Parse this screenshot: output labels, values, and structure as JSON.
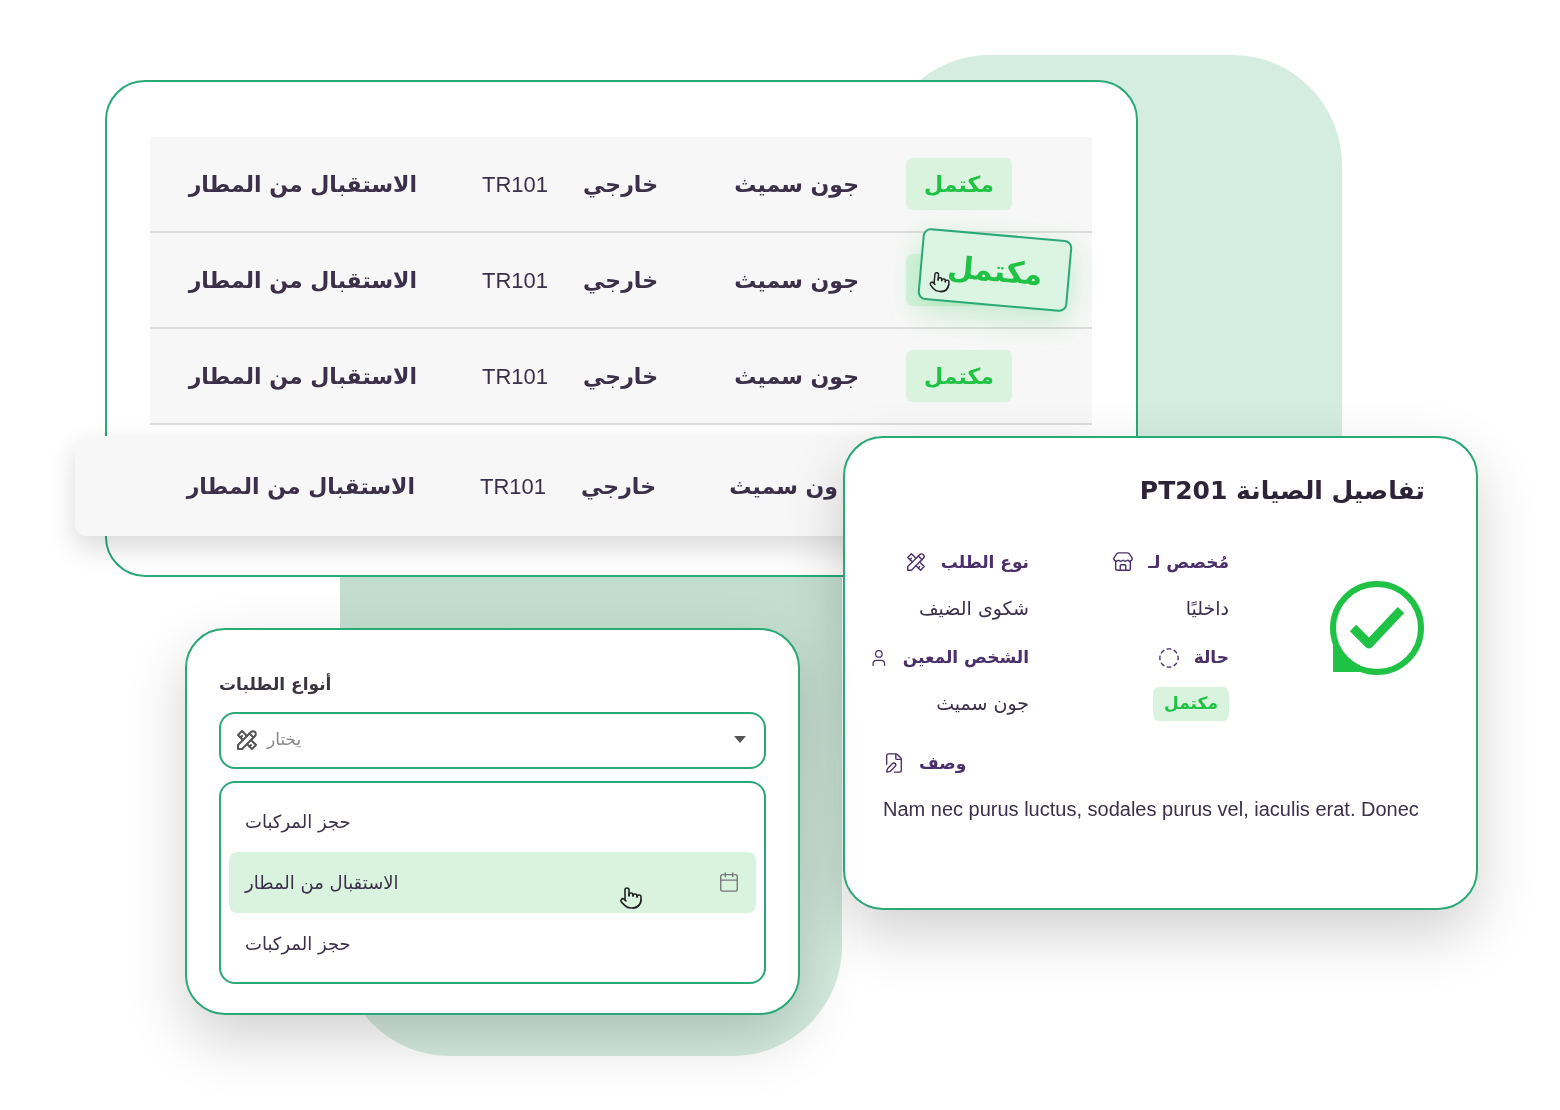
{
  "table": {
    "rows": [
      {
        "kind": "static",
        "status": "مكتمل",
        "name": "جون سميث",
        "type": "خارجي",
        "code": "TR101",
        "request": "الاستقبال من المطار"
      },
      {
        "kind": "dragged",
        "status": "مكتمل",
        "name": "جون سميث",
        "type": "خارجي",
        "code": "TR101",
        "request": "الاستقبال من المطار"
      },
      {
        "kind": "static",
        "status": "مكتمل",
        "name": "جون سميث",
        "type": "خارجي",
        "code": "TR101",
        "request": "الاستقبال من المطار"
      },
      {
        "kind": "lifted",
        "name": "ون سميث",
        "type": "خارجي",
        "code": "TR101",
        "request": "الاستقبال من المطار"
      }
    ]
  },
  "details": {
    "title": "تفاصيل الصيانة PT201",
    "fields": [
      {
        "label": "مُخصص لـ",
        "value": "داخليًا",
        "kind": "text"
      },
      {
        "label": "نوع الطلب",
        "value": "شكوى الضيف",
        "kind": "text"
      },
      {
        "label": "حالة",
        "value": "مكتمل",
        "kind": "badge"
      },
      {
        "label": "الشخص المعين",
        "value": "جون سميث",
        "kind": "text"
      }
    ],
    "description": {
      "label": "وصف",
      "text": "Nam nec purus luctus, sodales purus vel, iaculis erat. Donec"
    }
  },
  "request_types": {
    "label": "أنواع الطلبات",
    "select": {
      "placeholder": "يختار"
    },
    "options": [
      {
        "label": "حجز المركبات",
        "selected": false
      },
      {
        "label": "الاستقبال من المطار",
        "selected": true
      },
      {
        "label": "حجز المركبات",
        "selected": false
      }
    ]
  }
}
